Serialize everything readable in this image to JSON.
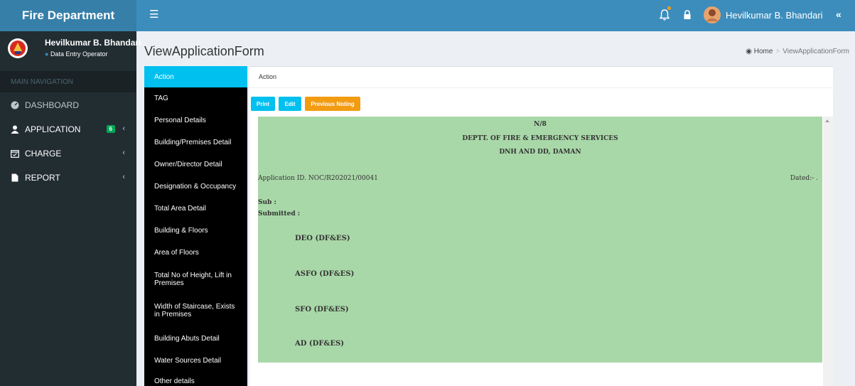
{
  "app": {
    "title": "Fire Department"
  },
  "topbar": {
    "user_name": "Hevilkumar B. Bhandari"
  },
  "sidebar": {
    "user_name": "Hevilkumar B. Bhandari",
    "user_role": "Data Entry Operator",
    "nav_header": "MAIN NAVIGATION",
    "items": [
      {
        "label": "DASHBOARD",
        "icon": "dashboard-icon"
      },
      {
        "label": "APPLICATION",
        "icon": "user-icon",
        "badge": "6"
      },
      {
        "label": "CHARGE",
        "icon": "calendar-icon"
      },
      {
        "label": "REPORT",
        "icon": "file-icon"
      }
    ]
  },
  "page": {
    "title": "ViewApplicationForm",
    "breadcrumb_home": "Home",
    "breadcrumb_current": "ViewApplicationForm"
  },
  "tabs": [
    "Action",
    "TAG",
    "Personal Details",
    "Building/Premises Detail",
    "Owner/Director Detail",
    "Designation & Occupancy",
    "Total Area Detail",
    "Building & Floors",
    "Area of Floors",
    "Total No of Height, Lift in Premises",
    "Width of Staircase, Exists in Premises",
    "Building Abuts Detail",
    "Water Sources Detail",
    "Other details"
  ],
  "content": {
    "box_title": "Action",
    "buttons": {
      "print": "Print",
      "edit": "Edit",
      "previous_noting": "Previous Noting"
    },
    "doc": {
      "noting_no": "N/8",
      "dept_line1": "DEPTT. OF FIRE & EMERGENCY SERVICES",
      "dept_line2": "DNH AND DD, DAMAN",
      "application_id": "Application ID. NOC/R202021/00041",
      "dated": "Dated:- .",
      "sub": "Sub :",
      "submitted": "Submitted :",
      "signatories": [
        "DEO (DF&ES)",
        "ASFO (DF&ES)",
        "SFO (DF&ES)",
        "AD (DF&ES)"
      ]
    }
  },
  "colors": {
    "header": "#3c8dbc",
    "logo_bg": "#367fa9",
    "sidebar": "#222d32",
    "active_tab": "#00c0ef",
    "doc_bg": "#a9d8a8",
    "warning": "#f39c12",
    "badge": "#00a65a"
  }
}
